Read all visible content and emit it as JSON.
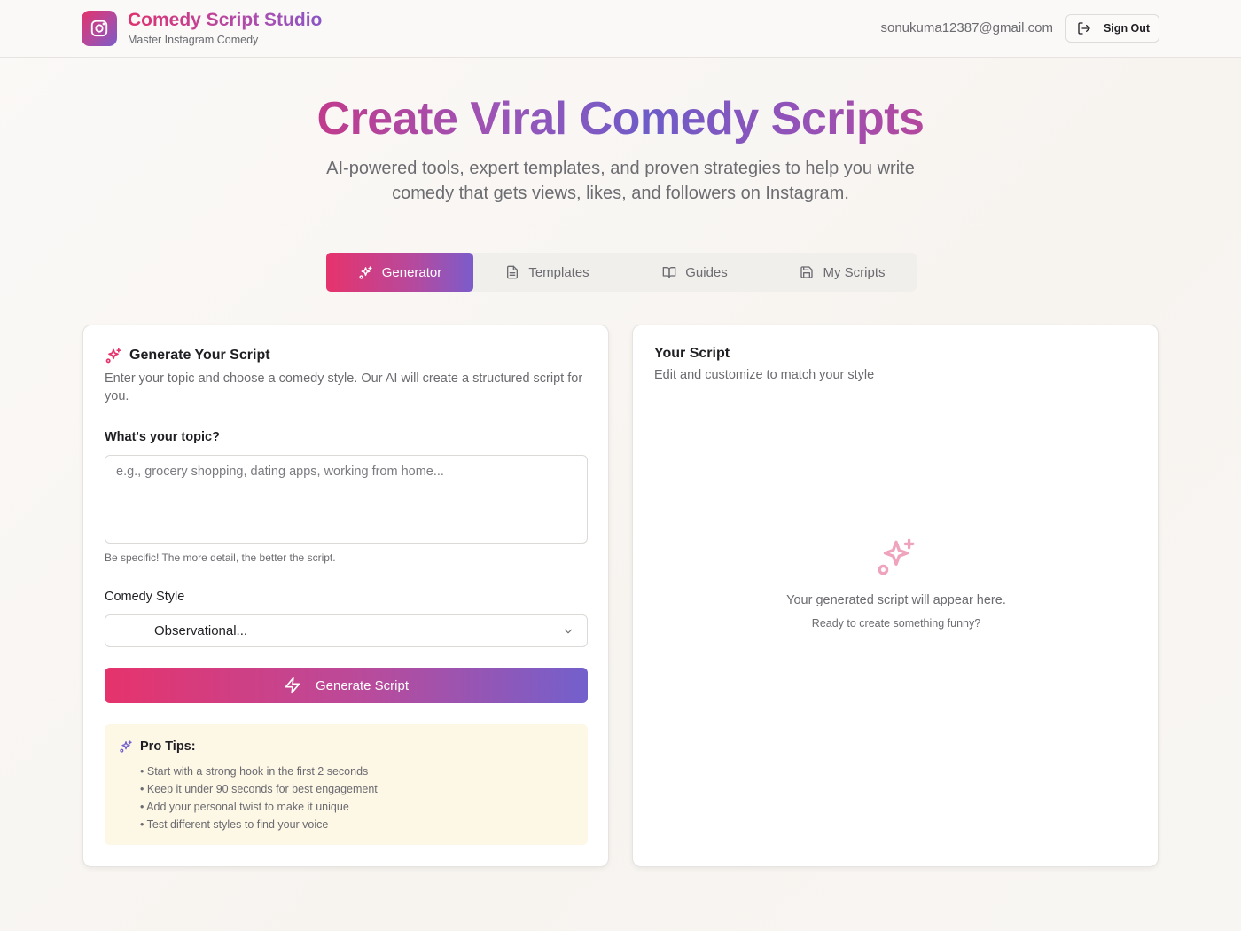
{
  "header": {
    "brand_title": "Comedy Script Studio",
    "brand_subtitle": "Master Instagram Comedy",
    "logo_icon": "instagram-icon",
    "user_email": "sonukuma12387@gmail.com",
    "signout_label": "Sign Out",
    "signout_icon": "log-out-icon"
  },
  "hero": {
    "title": "Create Viral Comedy Scripts",
    "subtitle": "AI-powered tools, expert templates, and proven strategies to help you write comedy that gets views, likes, and followers on Instagram."
  },
  "tabs": [
    {
      "label": "Generator",
      "icon": "sparkles-icon",
      "active": true
    },
    {
      "label": "Templates",
      "icon": "file-text-icon",
      "active": false
    },
    {
      "label": "Guides",
      "icon": "book-open-icon",
      "active": false
    },
    {
      "label": "My Scripts",
      "icon": "save-icon",
      "active": false
    }
  ],
  "generator": {
    "title": "Generate Your Script",
    "description": "Enter your topic and choose a comedy style. Our AI will create a structured script for you.",
    "topic_label": "What's your topic?",
    "topic_value": "",
    "topic_placeholder": "e.g., grocery shopping, dating apps, working from home...",
    "topic_hint": "Be specific! The more detail, the better the script.",
    "style_label": "Comedy Style",
    "style_selected": "Observational...",
    "generate_label": "Generate Script",
    "tips_title": "Pro Tips:",
    "tips": [
      "Start with a strong hook in the first 2 seconds",
      "Keep it under 90 seconds for best engagement",
      "Add your personal twist to make it unique",
      "Test different styles to find your voice"
    ]
  },
  "script_panel": {
    "title": "Your Script",
    "subtitle": "Edit and customize to match your style",
    "empty_message": "Your generated script will appear here.",
    "empty_sub": "Ready to create something funny?"
  },
  "colors": {
    "accent_pink": "#e6336c",
    "accent_purple": "#7360cc",
    "tips_bg": "#fdf7e6"
  }
}
